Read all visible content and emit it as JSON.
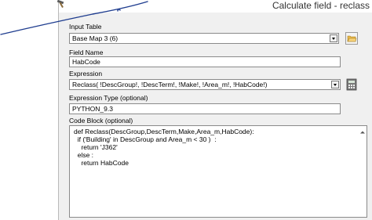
{
  "window": {
    "title": "Calculate field - reclass"
  },
  "input_table": {
    "label": "Input Table",
    "value": "Base Map 3 (6)"
  },
  "field_name": {
    "label": "Field Name",
    "value": "HabCode"
  },
  "expression": {
    "label": "Expression",
    "value": "Reclass( !DescGroup!, !DescTerm!, !Make!, !Area_m!, !HabCode!)"
  },
  "expression_type": {
    "label": "Expression Type (optional)",
    "value": "PYTHON_9.3"
  },
  "code_block": {
    "label": "Code Block (optional)",
    "lines": [
      "def Reclass(DescGroup,DescTerm,Make,Area_m,HabCode):",
      "  if ('Building' in DescGroup and Area_m < 30 )  :",
      "    return 'J362'",
      "  else :",
      "    return HabCode"
    ]
  },
  "colors": {
    "pen": "#1f3d8f",
    "folder": "#e8b84a",
    "calculator": "#6a6a6a"
  }
}
